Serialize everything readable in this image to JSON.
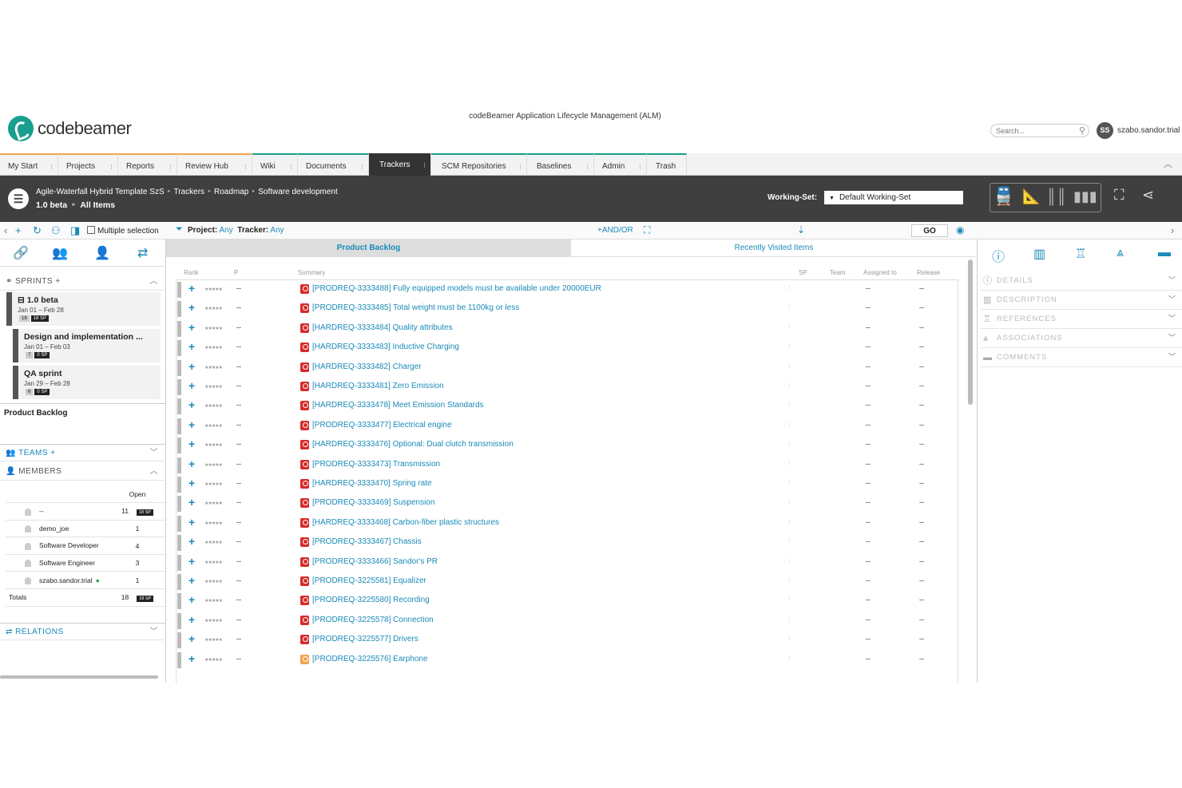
{
  "app": {
    "logo_text": "codebeamer",
    "title": "codeBeamer Application Lifecycle Management (ALM)",
    "search_placeholder": "Search...",
    "user_initials": "SS",
    "user_name": "szabo.sandor.trial"
  },
  "menu": [
    {
      "label": "My Start"
    },
    {
      "label": "Projects"
    },
    {
      "label": "Reports"
    },
    {
      "label": "Review Hub"
    },
    {
      "label": "Wiki"
    },
    {
      "label": "Documents"
    },
    {
      "label": "Trackers"
    },
    {
      "label": "SCM Repositories"
    },
    {
      "label": "Baselines"
    },
    {
      "label": "Admin"
    },
    {
      "label": "Trash"
    }
  ],
  "breadcrumb": {
    "items": [
      "Agile-Waterfall Hybrid Template SzS",
      "Trackers",
      "Roadmap",
      "Software development"
    ],
    "sub_release": "1.0 beta",
    "sub_view": "All Items"
  },
  "working_set": {
    "label": "Working-Set:",
    "value": "Default Working-Set"
  },
  "toolbar": {
    "multiple_selection": "Multiple selection",
    "project_label": "Project:",
    "project_value": "Any",
    "tracker_label": "Tracker:",
    "tracker_value": "Any",
    "andor": "+AND/OR",
    "go": "GO"
  },
  "left": {
    "sprints_label": "SPRINTS",
    "sprints": [
      {
        "name": "1.0 beta",
        "dates": "Jan 01 – Feb 28",
        "count": "18",
        "sp": "18 SP"
      },
      {
        "name": "Design and implementation ...",
        "dates": "Jan 01 – Feb 03",
        "count": "7",
        "sp": "0 SP"
      },
      {
        "name": "QA sprint",
        "dates": "Jan 29 – Feb 28",
        "count": "6",
        "sp": "0 SP"
      }
    ],
    "product_backlog": "Product Backlog",
    "teams_label": "TEAMS",
    "members_label": "MEMBERS",
    "members_header_open": "Open",
    "members": [
      {
        "name": "--",
        "open": "11",
        "sp": "18 SP"
      },
      {
        "name": "demo_joe",
        "open": "1",
        "sp": ""
      },
      {
        "name": "Software Developer",
        "open": "4",
        "sp": ""
      },
      {
        "name": "Software Engineer",
        "open": "3",
        "sp": ""
      },
      {
        "name": "szabo.sandor.trial",
        "open": "1",
        "sp": ""
      }
    ],
    "totals": {
      "label": "Totals",
      "open": "18",
      "sp": "18 SP"
    },
    "relations_label": "RELATIONS"
  },
  "center": {
    "tabs": [
      "Product Backlog",
      "Recently Visited Items"
    ],
    "columns": [
      "Rank",
      "P",
      "Summary",
      "SP",
      "Team",
      "Assigned to",
      "Release"
    ],
    "items": [
      {
        "summary": "[PRODREQ-3333488] Fully equipped models must be available under 20000EUR",
        "color": "#d62b2b"
      },
      {
        "summary": "[PRODREQ-3333485] Total weight must be 1100kg or less",
        "color": "#d62b2b"
      },
      {
        "summary": "[HARDREQ-3333484] Quality attributes",
        "color": "#d62b2b"
      },
      {
        "summary": "[HARDREQ-3333483] Inductive Charging",
        "color": "#d62b2b"
      },
      {
        "summary": "[HARDREQ-3333482] Charger",
        "color": "#d62b2b"
      },
      {
        "summary": "[HARDREQ-3333481] Zero Emission",
        "color": "#d62b2b"
      },
      {
        "summary": "[HARDREQ-3333478] Meet Emission Standards",
        "color": "#d62b2b"
      },
      {
        "summary": "[PRODREQ-3333477] Electrical engine",
        "color": "#d62b2b"
      },
      {
        "summary": "[HARDREQ-3333476] Optional: Dual clutch transmission",
        "color": "#d62b2b"
      },
      {
        "summary": "[PRODREQ-3333473] Transmission",
        "color": "#d62b2b"
      },
      {
        "summary": "[HARDREQ-3333470] Spring rate",
        "color": "#d62b2b"
      },
      {
        "summary": "[PRODREQ-3333469] Suspension",
        "color": "#d62b2b"
      },
      {
        "summary": "[HARDREQ-3333468] Carbon-fiber plastic structures",
        "color": "#d62b2b"
      },
      {
        "summary": "[PRODREQ-3333467] Chassis",
        "color": "#d62b2b"
      },
      {
        "summary": "[PRODREQ-3333466] Sandor's PR",
        "color": "#d62b2b"
      },
      {
        "summary": "[PRODREQ-3225581] Equalizer",
        "color": "#d62b2b"
      },
      {
        "summary": "[PRODREQ-3225580] Recording",
        "color": "#d62b2b"
      },
      {
        "summary": "[PRODREQ-3225578] Connection",
        "color": "#d62b2b"
      },
      {
        "summary": "[PRODREQ-3225577] Drivers",
        "color": "#d62b2b"
      },
      {
        "summary": "[PRODREQ-3225576] Earphone",
        "color": "#f0a54a"
      }
    ],
    "empty_value": "--"
  },
  "right": {
    "sections": [
      "DETAILS",
      "DESCRIPTION",
      "REFERENCES",
      "ASSOCIATIONS",
      "COMMENTS"
    ]
  },
  "colors": {
    "accent": "#1a8ab8",
    "dark_bar": "#3f3f3f",
    "requirement_red": "#d62b2b",
    "requirement_orange": "#f0a54a"
  }
}
